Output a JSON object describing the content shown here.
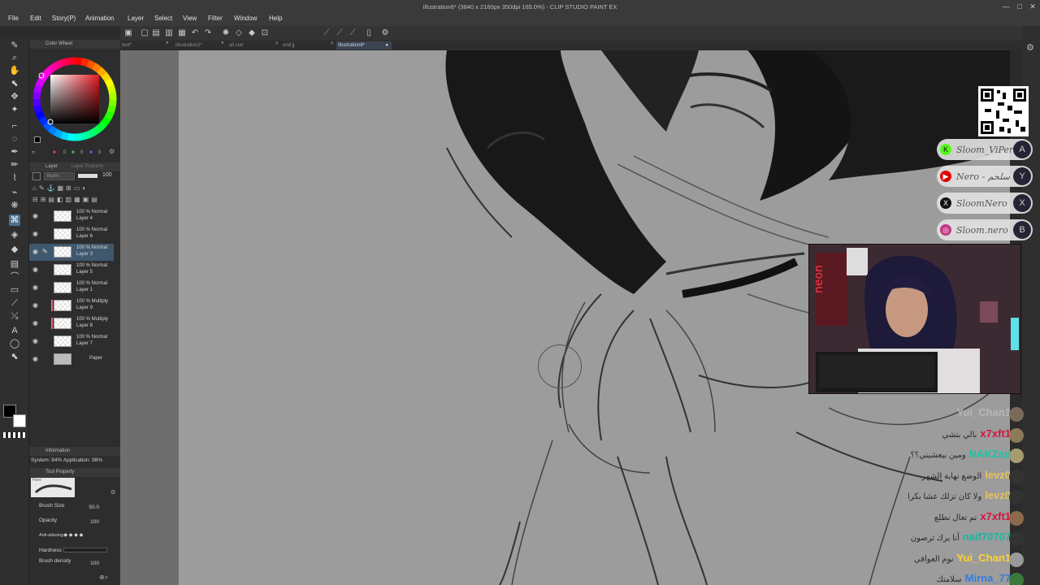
{
  "window": {
    "title": "Illustration6* (3840 x 2160px 350dpi 165.0%) - CLIP STUDIO PAINT EX",
    "controls": [
      "—",
      "□",
      "✕"
    ]
  },
  "menu": [
    "File",
    "Edit",
    "Story(P)",
    "Animation",
    "Layer",
    "Select",
    "View",
    "Filter",
    "Window",
    "Help"
  ],
  "tabs": [
    {
      "label": "text*",
      "active": false
    },
    {
      "label": "illustration2*",
      "active": false
    },
    {
      "label": "all cort",
      "active": false
    },
    {
      "label": "end jj",
      "active": false
    },
    {
      "label": "Illustration6*",
      "active": true
    }
  ],
  "color_panel": {
    "title": "Color Wheel",
    "hue_color": "#e41b23",
    "rgb": [
      "0",
      "0",
      "0"
    ]
  },
  "layer_panel": {
    "title": "Layer",
    "search_placeholder": "Layer Property",
    "blend_mode": "Norm",
    "opacity_value": "100",
    "layers": [
      {
        "mode": "100 % Normal",
        "name": "Layer 4",
        "selected": false,
        "marked": false,
        "editing": false
      },
      {
        "mode": "100 % Normal",
        "name": "Layer 6",
        "selected": false,
        "marked": false,
        "editing": false
      },
      {
        "mode": "100 % Normal",
        "name": "Layer 3",
        "selected": true,
        "marked": false,
        "editing": true
      },
      {
        "mode": "100 % Normal",
        "name": "Layer 5",
        "selected": false,
        "marked": false,
        "editing": false
      },
      {
        "mode": "100 % Normal",
        "name": "Layer 1",
        "selected": false,
        "marked": false,
        "editing": false
      },
      {
        "mode": "100 % Multiply",
        "name": "Layer 9",
        "selected": false,
        "marked": true,
        "editing": false
      },
      {
        "mode": "100 % Multiply",
        "name": "Layer 8",
        "selected": false,
        "marked": true,
        "editing": false
      },
      {
        "mode": "100 % Normal",
        "name": "Layer 7",
        "selected": false,
        "marked": false,
        "editing": false
      },
      {
        "mode": "",
        "name": "Paper",
        "selected": false,
        "marked": false,
        "editing": false
      }
    ]
  },
  "info_panel": {
    "title": "Information",
    "system_text": "System: 84%  Application: 98%"
  },
  "tool_property": {
    "title": "Tool Property",
    "brush_label": "Hard",
    "props": [
      {
        "label": "Brush Size",
        "value": "50.0"
      },
      {
        "label": "Opacity",
        "value": "100"
      },
      {
        "label": "Anti-aliasing",
        "value": ""
      },
      {
        "label": "Hardness",
        "value": ""
      },
      {
        "label": "Brush density",
        "value": "100"
      }
    ]
  },
  "socials": [
    {
      "icon": "K",
      "text": "Sloom_ViPer",
      "badge": "A",
      "icon_color": "#53fc18"
    },
    {
      "icon": "▶",
      "text": "Nero - سلحم",
      "badge": "Y",
      "icon_color": "#e00000"
    },
    {
      "icon": "X",
      "text": "SloomNero",
      "badge": "X",
      "icon_color": "#111111"
    },
    {
      "icon": "◎",
      "text": "Sloom.nero",
      "badge": "B",
      "icon_color": "#c13584"
    }
  ],
  "chat": [
    {
      "user": "Yui_Chan1",
      "msg": "",
      "color": "#b7b7b7"
    },
    {
      "user": "x7xft1",
      "msg": "بالي بتشي",
      "color": "#d4143f"
    },
    {
      "user": "NAKZsp",
      "msg": "ومين بيعشيني؟؟",
      "color": "#14c8a4"
    },
    {
      "user": "levz0",
      "msg": "الوضع نهاية الشهر",
      "color": "#e8c25a"
    },
    {
      "user": "levz0",
      "msg": "ولا كان تزلك عشا بكرا",
      "color": "#e8c25a"
    },
    {
      "user": "x7xft1",
      "msg": "تم تعال نطلع",
      "color": "#d4143f"
    },
    {
      "user": "naif70707",
      "msg": "أنا برك ترصون",
      "color": "#14b8a0"
    },
    {
      "user": "Yui_Chan1",
      "msg": "نوم العوافي",
      "color": "#ffd233"
    },
    {
      "user": "Mirna_77",
      "msg": "سلامتك",
      "color": "#3a7bd5"
    }
  ]
}
